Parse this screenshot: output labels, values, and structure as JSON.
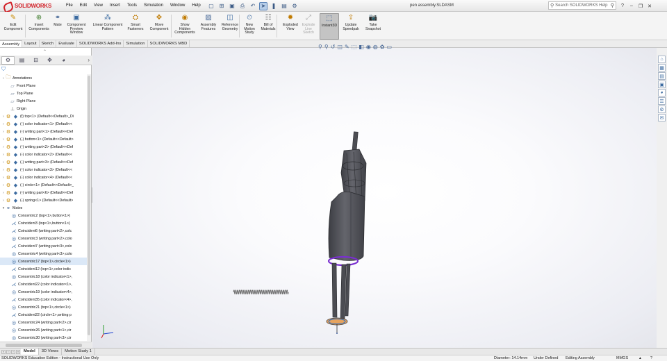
{
  "app": {
    "logo_text": "SOLIDWORKS",
    "document_title": "pen assembly.SLDASM",
    "menu": [
      "File",
      "Edit",
      "View",
      "Insert",
      "Tools",
      "Simulation",
      "Window",
      "Help"
    ],
    "search_placeholder": "Search SOLIDWORKS Help",
    "colors": {
      "brand_red": "#d2232a",
      "selection_blue": "#dbe8f7",
      "model_gray": "#55565c",
      "mate_purple": "#7a2fd0",
      "spring_gray": "#6c6c6c"
    }
  },
  "ribbon": [
    {
      "label": "Edit\nComponent",
      "icon": "edit-component-icon"
    },
    {
      "label": "Insert\nComponents",
      "icon": "insert-components-icon"
    },
    {
      "label": "Mate",
      "icon": "mate-icon"
    },
    {
      "label": "Component\nPreview\nWindow",
      "icon": "preview-window-icon"
    },
    {
      "label": "Linear Component\nPattern",
      "icon": "linear-pattern-icon"
    },
    {
      "label": "Smart\nFasteners",
      "icon": "smart-fasteners-icon"
    },
    {
      "label": "Move\nComponent",
      "icon": "move-component-icon"
    },
    {
      "label": "Show\nHidden\nComponents",
      "icon": "show-hidden-icon"
    },
    {
      "label": "Assembly\nFeatures",
      "icon": "assembly-features-icon"
    },
    {
      "label": "Reference\nGeometry",
      "icon": "reference-geometry-icon"
    },
    {
      "label": "New\nMotion\nStudy",
      "icon": "motion-study-icon"
    },
    {
      "label": "Bill of\nMaterials",
      "icon": "bill-of-materials-icon"
    },
    {
      "label": "Exploded\nView",
      "icon": "exploded-view-icon"
    },
    {
      "label": "Explode\nLine\nSketch",
      "icon": "explode-line-sketch-icon"
    },
    {
      "label": "Instant3D",
      "icon": "instant3d-icon"
    },
    {
      "label": "Update\nSpeedpak",
      "icon": "speedpak-icon"
    },
    {
      "label": "Take\nSnapshot",
      "icon": "snapshot-icon"
    }
  ],
  "tabs": [
    "Assembly",
    "Layout",
    "Sketch",
    "Evaluate",
    "SOLIDWORKS Add-Ins",
    "Simulation",
    "SOLIDWORKS MBD"
  ],
  "tree": [
    {
      "label": "Annotations",
      "type": "annotation"
    },
    {
      "label": "Front Plane",
      "type": "plane"
    },
    {
      "label": "Top Plane",
      "type": "plane"
    },
    {
      "label": "Right Plane",
      "type": "plane"
    },
    {
      "label": "Origin",
      "type": "origin"
    },
    {
      "label": "(f) top<1> (Default<<Default>_Di",
      "type": "part"
    },
    {
      "label": "(-) color indicator<1> (Default<<",
      "type": "part"
    },
    {
      "label": "(-) writing part<1> (Default<<Def",
      "type": "part"
    },
    {
      "label": "(-) button<1> (Default<<Default>",
      "type": "part"
    },
    {
      "label": "(-) writing part<2> (Default<<Def",
      "type": "part"
    },
    {
      "label": "(-) color indicator<2> (Default<<",
      "type": "part"
    },
    {
      "label": "(-) writing part<3> (Default<<Def",
      "type": "part"
    },
    {
      "label": "(-) color indicator<3> (Default<<",
      "type": "part"
    },
    {
      "label": "(-) color indicator<4> (Default<<",
      "type": "part"
    },
    {
      "label": "(-) circle<1> (Default<<Default>_",
      "type": "part"
    },
    {
      "label": "(-) writing part<6> (Default<<Def",
      "type": "part"
    },
    {
      "label": "(-) spring<1> (Default<<Default>",
      "type": "part"
    },
    {
      "label": "Mates",
      "type": "mates"
    },
    {
      "label": "Concentric2 (top<1>,button<1>)",
      "type": "concentric"
    },
    {
      "label": "Coincident3 (top<1>,button<1>)",
      "type": "coincident"
    },
    {
      "label": "Coincident6 (writing part<2>,colc",
      "type": "coincident"
    },
    {
      "label": "Concentric3 (writing part<2>,colo",
      "type": "concentric"
    },
    {
      "label": "Coincident7 (writing part<3>,colo",
      "type": "coincident"
    },
    {
      "label": "Concentric4 (writing part<3>,colo",
      "type": "concentric"
    },
    {
      "label": "Concentric17 (top<1>,circle<1>)",
      "type": "concentric",
      "selected": true
    },
    {
      "label": "Coincident12 (top<1>,color indic",
      "type": "coincident"
    },
    {
      "label": "Concentric18 (color indicator<1>,",
      "type": "concentric"
    },
    {
      "label": "Coincident22 (color indicator<1>,",
      "type": "coincident"
    },
    {
      "label": "Concentric19 (color indicator<4>,",
      "type": "concentric"
    },
    {
      "label": "Coincident35 (color indicator<4>,",
      "type": "coincident"
    },
    {
      "label": "Concentric21 (top<1>,circle<1>)",
      "type": "concentric"
    },
    {
      "label": "Coincident22 (circle<1>,writing p",
      "type": "coincident"
    },
    {
      "label": "Concentric24 (writing part<2>,cir",
      "type": "concentric"
    },
    {
      "label": "Concentric26 (writing part<1>,cir",
      "type": "concentric"
    },
    {
      "label": "Concentric30 (writing part<3>,cir",
      "type": "concentric"
    }
  ],
  "bottom_tabs": [
    "Model",
    "3D Views",
    "Motion Study 1"
  ],
  "status": {
    "edition": "SOLIDWORKS Education Edition - Instructional Use Only",
    "measure": "Diameter: 14.14mm",
    "definition": "Under Defined",
    "mode": "Editing Assembly",
    "units": "MMGS"
  }
}
